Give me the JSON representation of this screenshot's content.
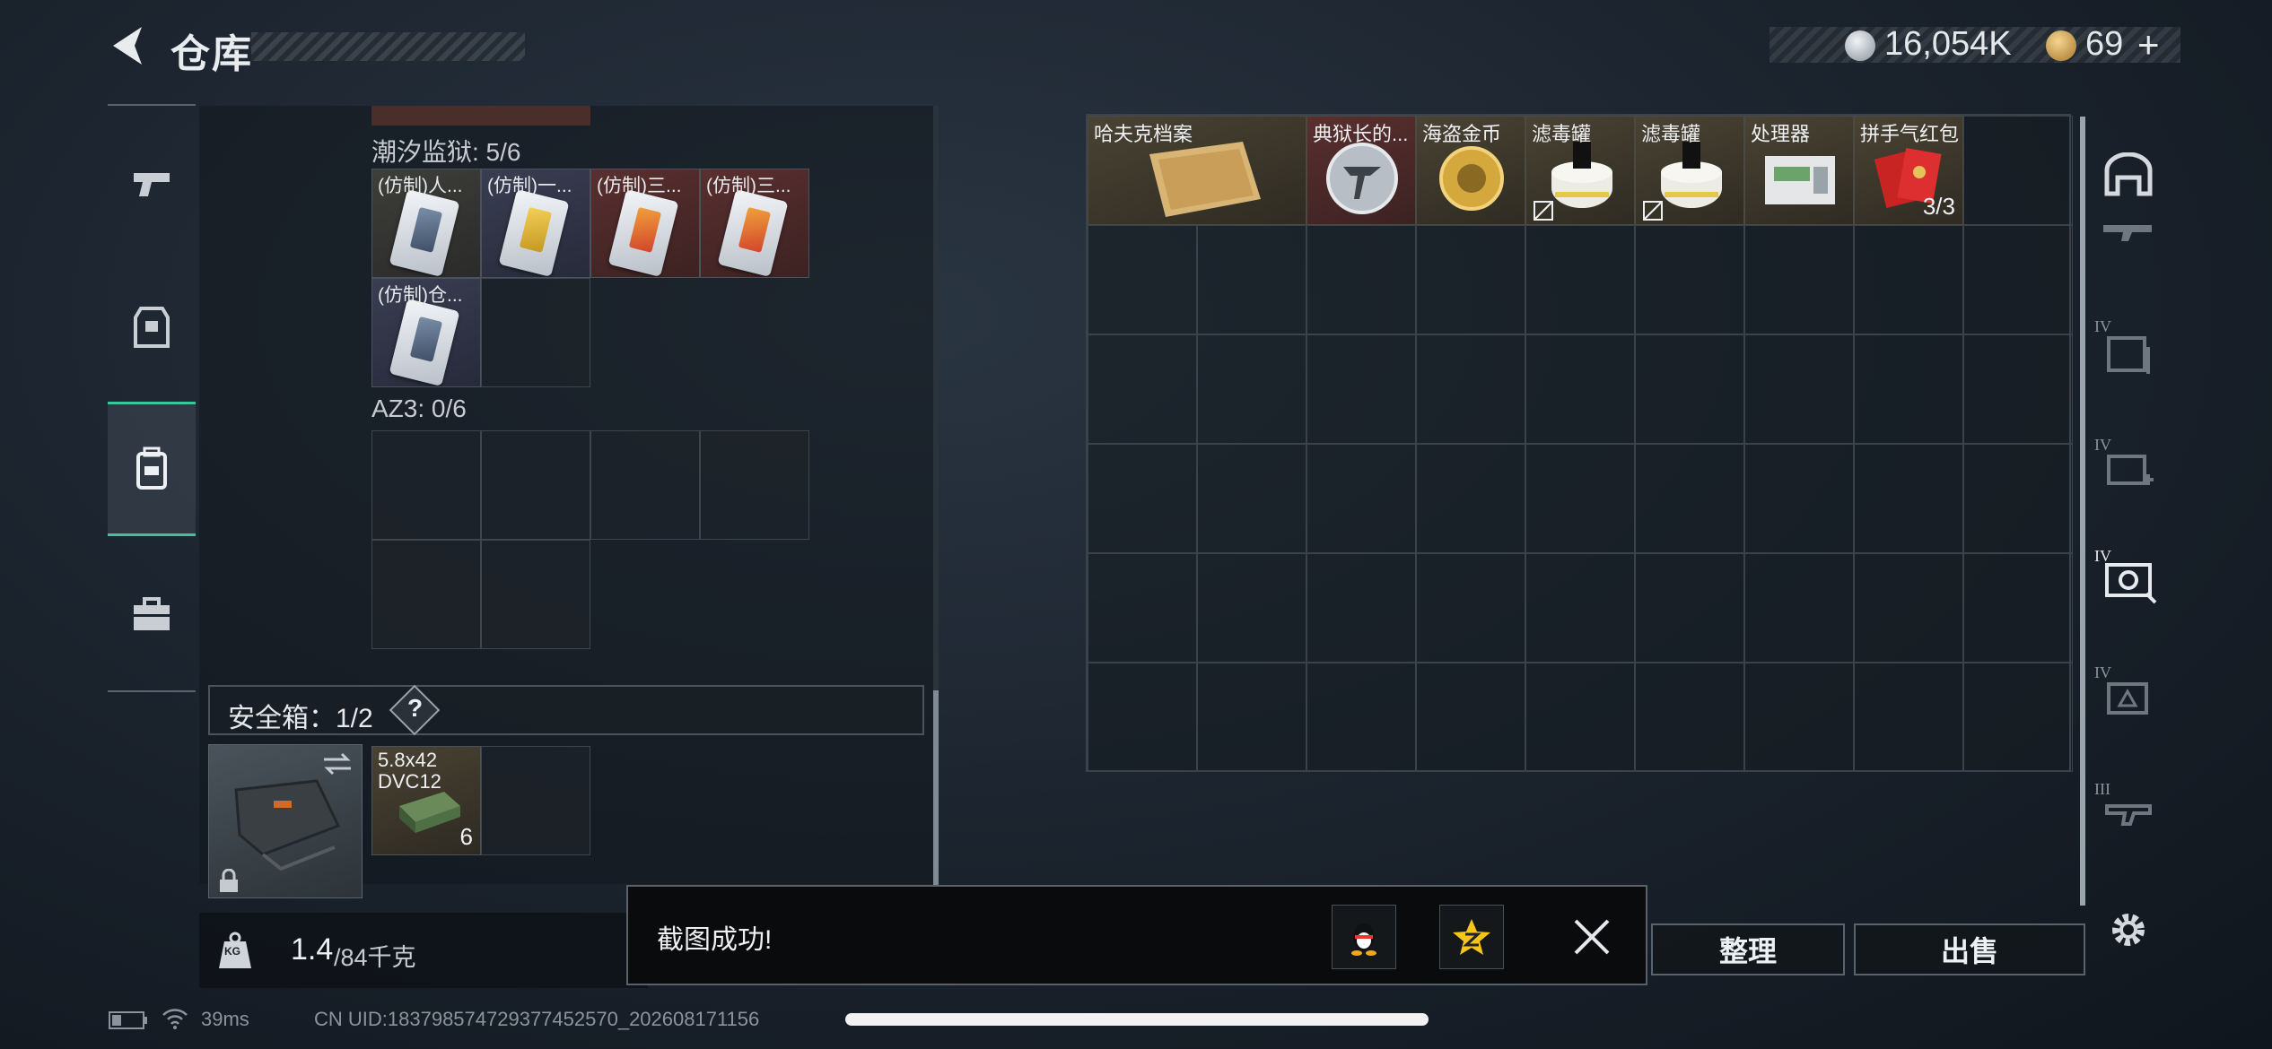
{
  "header": {
    "title": "仓库",
    "currency1": "16,054K",
    "currency2": "69",
    "plus": "+"
  },
  "left_nav": {
    "items": [
      "firearms",
      "equipment",
      "backpack",
      "toolbox"
    ],
    "active": "backpack"
  },
  "containers": {
    "section1": {
      "label": "潮汐监狱: 5/6",
      "items": [
        {
          "name": "(仿制)人...",
          "accent": "gray"
        },
        {
          "name": "(仿制)一...",
          "accent": "yellow"
        },
        {
          "name": "(仿制)三...",
          "accent": "red"
        },
        {
          "name": "(仿制)三...",
          "accent": "red"
        },
        {
          "name": "(仿制)仓...",
          "accent": "gray"
        }
      ]
    },
    "section2": {
      "label": "AZ3: 0/6"
    }
  },
  "safe_box": {
    "label": "安全箱：1/2",
    "help": "?",
    "item": {
      "name_line1": "5.8x42",
      "name_line2": "DVC12",
      "count": "6"
    }
  },
  "weight": {
    "value": "1.4",
    "max": "/84千克",
    "icon_label": "KG"
  },
  "stash": {
    "items": [
      {
        "name": "哈夫克档案",
        "count": ""
      },
      {
        "name": "典狱长的...",
        "count": ""
      },
      {
        "name": "海盗金币",
        "count": ""
      },
      {
        "name": "滤毒罐",
        "count": ""
      },
      {
        "name": "滤毒罐",
        "count": ""
      },
      {
        "name": "处理器",
        "count": ""
      },
      {
        "name": "拼手气红包",
        "count": "3/3"
      }
    ]
  },
  "right_nav": {
    "labels": [
      "IV",
      "IV",
      "IV",
      "IV",
      "III"
    ]
  },
  "actions": {
    "organize": "整理",
    "sell": "出售"
  },
  "toast": {
    "message": "截图成功!",
    "share_qq": "qq-icon",
    "share_qzone": "qzone-icon"
  },
  "status_bar": {
    "ping": "39ms",
    "uid": "CN UID:183798574729377452570_202608171156"
  },
  "colors": {
    "accent_green": "#3ec39a",
    "coin_silver": "#c9ced4",
    "coin_gold": "#d9a54a",
    "red_bg": "#4a2a2a"
  }
}
